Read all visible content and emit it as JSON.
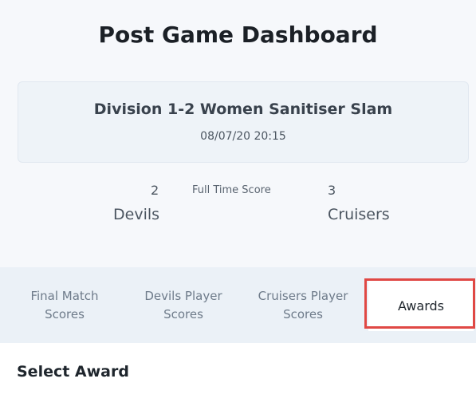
{
  "header": {
    "title": "Post Game Dashboard"
  },
  "match": {
    "name": "Division 1-2 Women Sanitiser Slam",
    "datetime": "08/07/20 20:15"
  },
  "score": {
    "label": "Full Time Score",
    "home": {
      "team": "Devils",
      "score": "2"
    },
    "away": {
      "team": "Cruisers",
      "score": "3"
    }
  },
  "tabs": [
    {
      "line1": "Final Match",
      "line2": "Scores",
      "active": false
    },
    {
      "line1": "Devils Player",
      "line2": "Scores",
      "active": false
    },
    {
      "line1": "Cruisers Player",
      "line2": "Scores",
      "active": false
    },
    {
      "line1": "Awards",
      "line2": "",
      "active": true
    }
  ],
  "awards": {
    "heading": "Select Award"
  },
  "colors": {
    "highlight": "#e04844",
    "panel_background": "#f6f8fb",
    "tab_bar_background": "#ebf1f7"
  }
}
